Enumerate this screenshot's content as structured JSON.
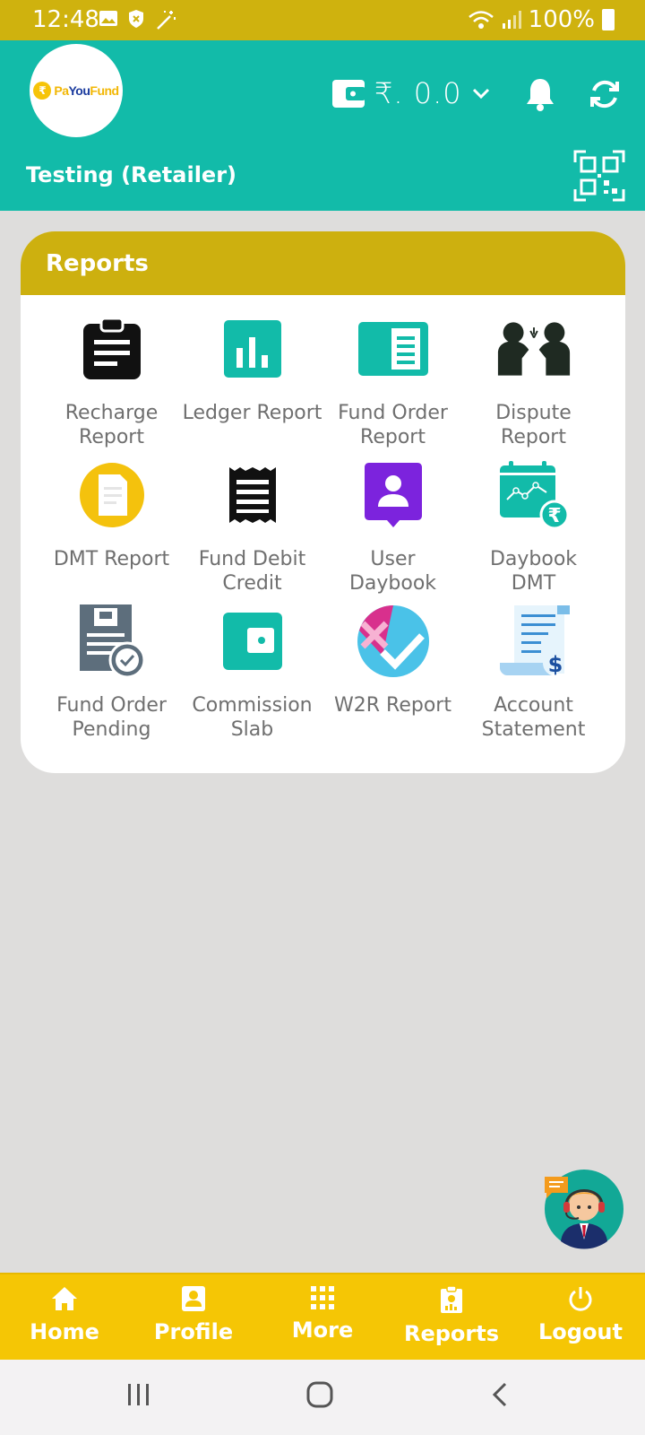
{
  "status_bar": {
    "time": "12:48",
    "battery": "100%"
  },
  "header": {
    "logo_text_primary": "Pa",
    "logo_text_brand": "You",
    "logo_text_tail": "Fund",
    "wallet_amount": "₹. 0.0",
    "user_label": "Testing (Retailer)"
  },
  "reports": {
    "title": "Reports",
    "items": [
      {
        "label": "Recharge\nReport",
        "icon": "clipboard-icon"
      },
      {
        "label": "Ledger Report",
        "icon": "bar-chart-icon"
      },
      {
        "label": "Fund Order\nReport",
        "icon": "document-icon"
      },
      {
        "label": "Dispute\nReport",
        "icon": "dispute-people-icon"
      },
      {
        "label": "DMT Report",
        "icon": "paper-circle-icon"
      },
      {
        "label": "Fund Debit\nCredit",
        "icon": "receipt-icon"
      },
      {
        "label": "User\nDaybook",
        "icon": "user-badge-icon"
      },
      {
        "label": "Daybook\nDMT",
        "icon": "calendar-rupee-icon"
      },
      {
        "label": "Fund Order\nPending",
        "icon": "pending-document-icon"
      },
      {
        "label": "Commission\nSlab",
        "icon": "wallet-icon"
      },
      {
        "label": "W2R Report",
        "icon": "check-cross-icon"
      },
      {
        "label": "Account\nStatement",
        "icon": "statement-scroll-icon"
      }
    ]
  },
  "bottom_nav": [
    {
      "label": "Home",
      "icon": "home-icon"
    },
    {
      "label": "Profile",
      "icon": "profile-icon"
    },
    {
      "label": "More",
      "icon": "grid-icon"
    },
    {
      "label": "Reports",
      "icon": "report-clipboard-icon"
    },
    {
      "label": "Logout",
      "icon": "power-icon"
    }
  ]
}
